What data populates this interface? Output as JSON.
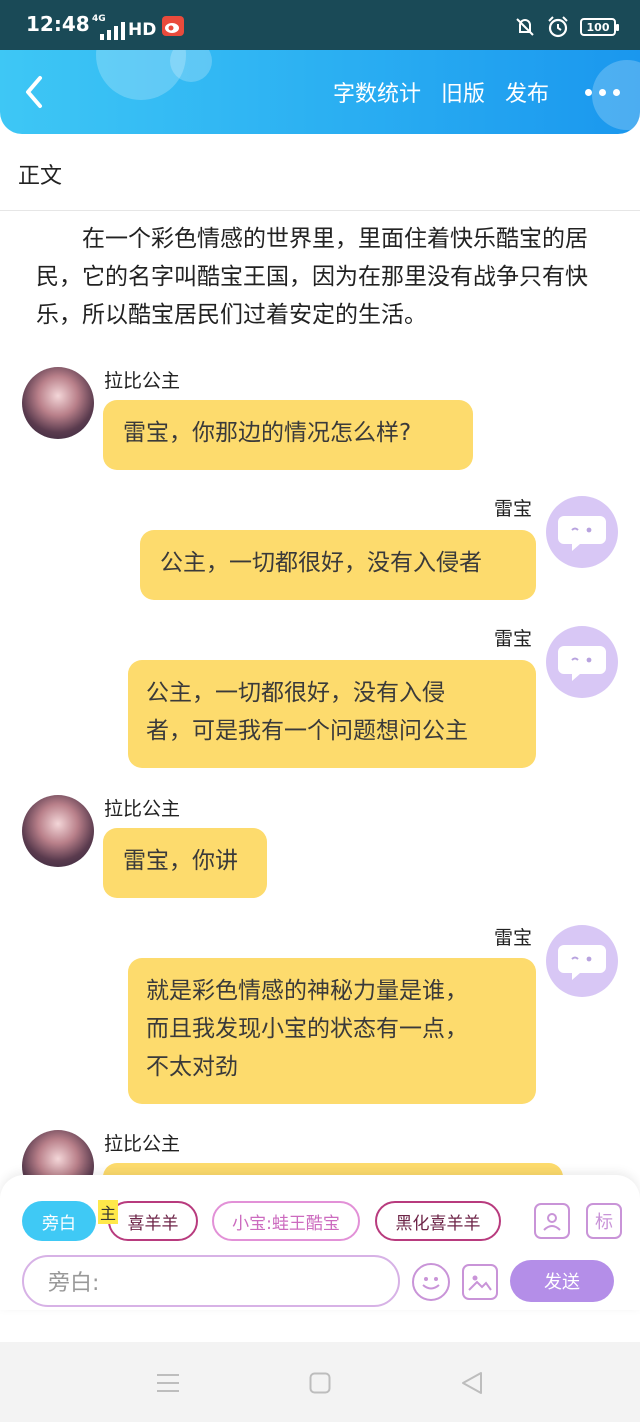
{
  "status_bar": {
    "time": "12:48",
    "network_small": "4G",
    "network": "HD",
    "battery": "100"
  },
  "top_bar": {
    "actions": [
      "字数统计",
      "旧版",
      "发布"
    ]
  },
  "section": {
    "title": "正文"
  },
  "narration": "在一个彩色情感的世界里，里面住着快乐酷宝的居民，它的名字叫酷宝王国，因为在那里没有战争只有快乐，所以酷宝居民们过着安定的生活。",
  "messages": [
    {
      "speaker": "拉比公主",
      "side": "left",
      "text": "雷宝，你那边的情况怎么样?"
    },
    {
      "speaker": "雷宝",
      "side": "right",
      "text": "公主，一切都很好，没有入侵者"
    },
    {
      "speaker": "雷宝",
      "side": "right",
      "line1": "公主，一切都很好，没有入侵",
      "line2": "者，可是我有一个问题想问公主"
    },
    {
      "speaker": "拉比公主",
      "side": "left",
      "text": "雷宝，你讲"
    },
    {
      "speaker": "雷宝",
      "side": "right",
      "line1": "就是彩色情感的神秘力量是谁，",
      "line2": "而且我发现小宝的状态有一点，",
      "line3": "不太对劲"
    },
    {
      "speaker": "拉比公主",
      "side": "left",
      "text": ""
    }
  ],
  "composer": {
    "chips": [
      "旁白",
      "喜羊羊",
      "小宝:蛙王酷宝",
      "黑化喜羊羊"
    ],
    "main_tag": "主",
    "mark_label": "标",
    "input_placeholder": "旁白:",
    "send_label": "发送"
  },
  "colors": {
    "app_bar": "#2aaef2",
    "bubble": "#fddb6d",
    "active_chip": "#3fc9f5",
    "send": "#b48ee8"
  }
}
